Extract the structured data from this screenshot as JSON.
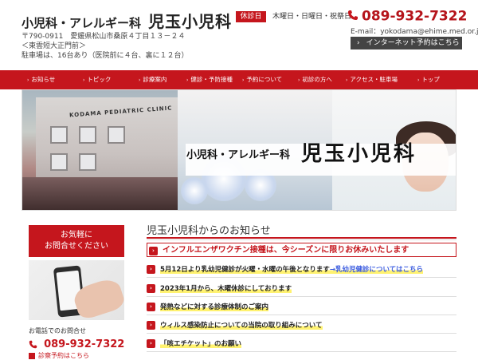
{
  "header": {
    "title_sub": "小児科・アレルギー科",
    "title_main": "児玉小児科",
    "postal": "〒790-0911　愛媛県松山市桑原４丁目１３－２４",
    "landmark": "＜東雲短大正門前＞",
    "parking": "駐車場は、16台あり（医院前に４台、裏に１２台）",
    "closed_badge": "休診日",
    "closed_days": "木曜日・日曜日・祝祭日",
    "phone": "089-932-7322",
    "email": "E-mail：yokodama@ehime.med.or.jp",
    "reserve_label": "インターネット予約はこちら"
  },
  "nav": {
    "items": [
      {
        "label": "お知らせ"
      },
      {
        "label": "トピック"
      },
      {
        "label": "診療案内"
      },
      {
        "label": "健診・予防接種"
      },
      {
        "label": "予約について"
      },
      {
        "label": "初診の方へ"
      },
      {
        "label": "アクセス・駐車場"
      },
      {
        "label": "トップ"
      }
    ]
  },
  "hero": {
    "sub": "小児科・アレルギー科",
    "main": "児玉小児科",
    "building_sign": "KODAMA PEDIATRIC CLINIC"
  },
  "sidebar": {
    "contact_line1": "お気軽に",
    "contact_line2": "お問合せください",
    "phone_label": "お電話でのお問合せ",
    "phone": "089-932-7322",
    "reserve_link": "診察予約はこちら"
  },
  "news": {
    "title": "児玉小児科からのお知らせ",
    "items": [
      {
        "text": "インフルエンザワクチン接種は、今シーズンに限りお休みいたします"
      },
      {
        "text": "5月12日より乳幼児健診が火曜・水曜の午後となります",
        "link": "→乳幼児健診についてはこちら"
      },
      {
        "text": "2023年1月から、木曜休診にしております"
      },
      {
        "text": "発熱などに対する診療体制のご案内"
      },
      {
        "text": "ウィルス感染防止についての当院の取り組みについて"
      },
      {
        "text": "「咳エチケット」のお願い"
      }
    ]
  },
  "colors": {
    "accent": "#c5161d",
    "link": "#3a5be0",
    "highlight": "#fff270"
  }
}
